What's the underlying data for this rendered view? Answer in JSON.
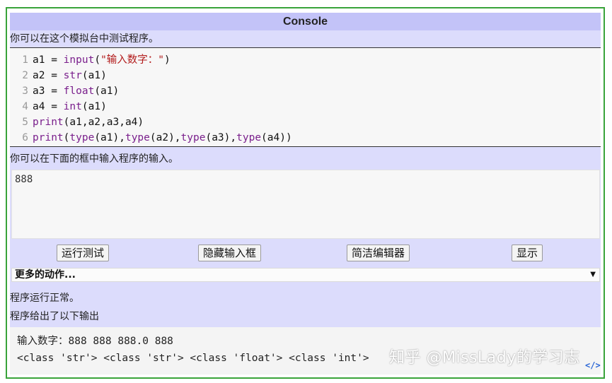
{
  "console": {
    "title": "Console",
    "caption_top": "你可以在这个模拟台中测试程序。",
    "code_lines": [
      {
        "num": "1",
        "tokens": [
          [
            "var",
            "a1"
          ],
          [
            "op",
            " = "
          ],
          [
            "builtin",
            "input"
          ],
          [
            "op",
            "("
          ],
          [
            "str",
            "\"输入数字：\""
          ],
          [
            "op",
            ")"
          ]
        ]
      },
      {
        "num": "2",
        "tokens": [
          [
            "var",
            "a2"
          ],
          [
            "op",
            " = "
          ],
          [
            "builtin",
            "str"
          ],
          [
            "op",
            "(a1)"
          ]
        ]
      },
      {
        "num": "3",
        "tokens": [
          [
            "var",
            "a3"
          ],
          [
            "op",
            " = "
          ],
          [
            "builtin",
            "float"
          ],
          [
            "op",
            "(a1)"
          ]
        ]
      },
      {
        "num": "4",
        "tokens": [
          [
            "var",
            "a4"
          ],
          [
            "op",
            " = "
          ],
          [
            "builtin",
            "int"
          ],
          [
            "op",
            "(a1)"
          ]
        ]
      },
      {
        "num": "5",
        "tokens": [
          [
            "builtin",
            "print"
          ],
          [
            "op",
            "(a1,a2,a3,a4)"
          ]
        ]
      },
      {
        "num": "6",
        "tokens": [
          [
            "builtin",
            "print"
          ],
          [
            "op",
            "("
          ],
          [
            "builtin",
            "type"
          ],
          [
            "op",
            "(a1),"
          ],
          [
            "builtin",
            "type"
          ],
          [
            "op",
            "(a2),"
          ],
          [
            "builtin",
            "type"
          ],
          [
            "op",
            "(a3),"
          ],
          [
            "builtin",
            "type"
          ],
          [
            "op",
            "(a4))"
          ]
        ]
      }
    ],
    "caption_input": "你可以在下面的框中输入程序的输入。",
    "input_value": "888",
    "buttons": {
      "run": "运行测试",
      "hide_input": "隐藏输入框",
      "simple_editor": "简洁编辑器",
      "show": "显示"
    },
    "more_actions": "更多的动作...",
    "status": "程序运行正常。",
    "output_caption": "程序给出了以下输出",
    "output_lines": [
      "输入数字：888 888 888.0 888",
      "<class 'str'> <class 'str'> <class 'float'> <class 'int'>"
    ],
    "watermark": "知乎 @MissLady的学习志",
    "code_icon": "</>"
  }
}
